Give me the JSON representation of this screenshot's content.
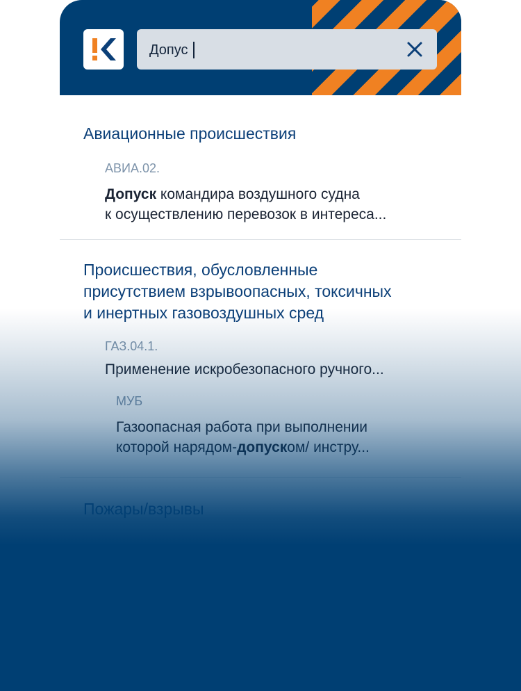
{
  "search": {
    "value": "Допус",
    "clear_icon": "close-icon"
  },
  "logo": {
    "icon": "k-logo-icon",
    "color_accent": "#f08122",
    "color_brand": "#0b3f78"
  },
  "groups": [
    {
      "title": "Авиационные происшествия",
      "items": [
        {
          "code": "АВИА.02.",
          "text_bold": "Допуск",
          "text_line1_rest": " командира воздушного судна",
          "text_line2": "к осуществлению перевозок в интереса..."
        }
      ]
    },
    {
      "title_line1": "Происшествия, обусловленные",
      "title_line2": "присутствием взрывоопасных, токсичных",
      "title_line3": "и инертных газовоздушных сред",
      "items": [
        {
          "code": "ГАЗ.04.1.",
          "text": "Применение искробезопасного ручного..."
        },
        {
          "code": "МУБ",
          "text_line1": "Газоопасная работа при выполнении",
          "text_line2_pre": "которой нарядом-",
          "text_line2_bold": "допуск",
          "text_line2_post": "ом/ инстру..."
        }
      ]
    },
    {
      "title": "Пожары/взрывы"
    }
  ]
}
